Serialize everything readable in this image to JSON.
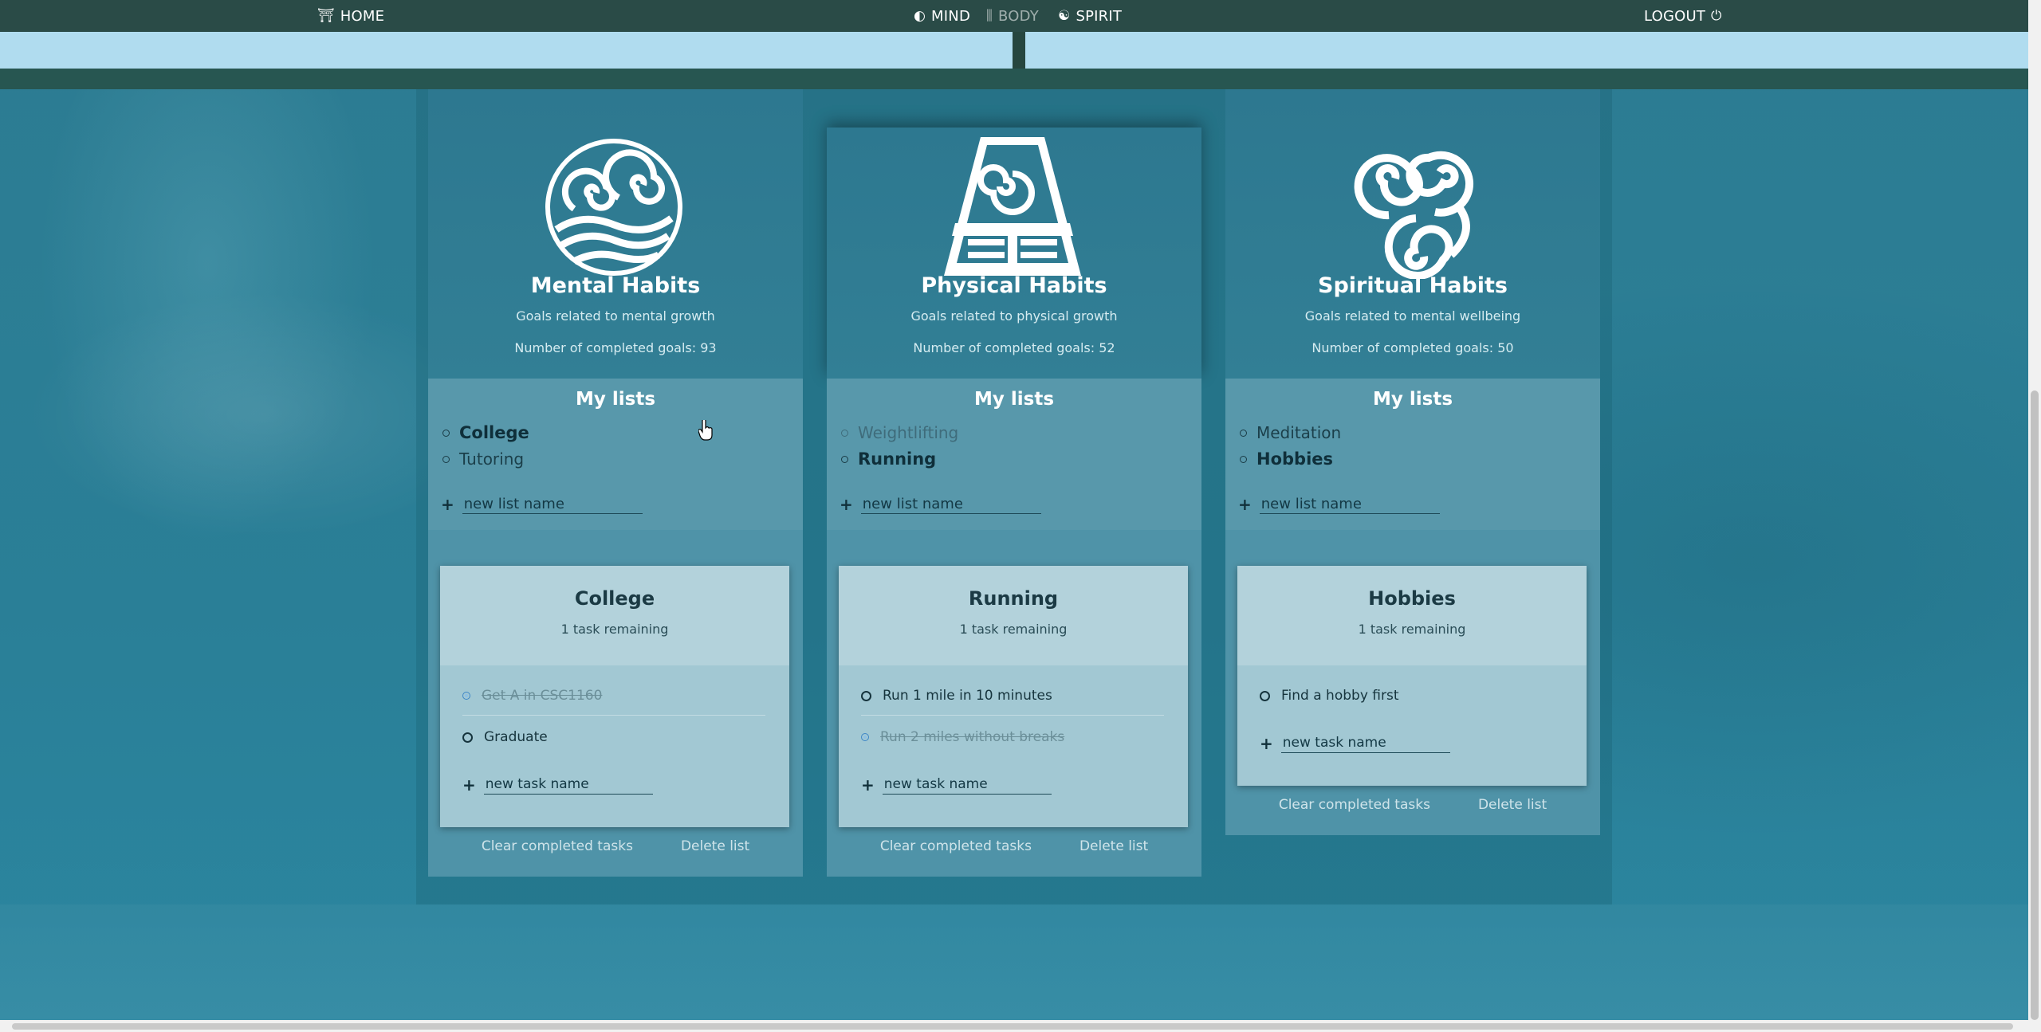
{
  "nav": {
    "home": "HOME",
    "mind": "MIND",
    "body": "BODY",
    "spirit": "SPIRIT",
    "logout": "LOGOUT"
  },
  "columns": [
    {
      "emblem": "water-tribe-emblem",
      "title": "Mental Habits",
      "description": "Goals related to mental growth",
      "completed": "Number of completed goals: 93",
      "lists_title": "My lists",
      "lists": [
        {
          "label": "College",
          "state": "active"
        },
        {
          "label": "Tutoring",
          "state": "normal"
        }
      ],
      "new_list_placeholder": "new list name",
      "card": {
        "title": "College",
        "remaining": "1 task remaining",
        "tasks": [
          {
            "label": "Get A in CSC1160",
            "done": true
          },
          {
            "label": "Graduate",
            "done": false
          }
        ],
        "new_task_placeholder": "new task name",
        "clear_label": "Clear completed tasks",
        "delete_label": "Delete list"
      }
    },
    {
      "emblem": "earth-kingdom-emblem",
      "title": "Physical Habits",
      "description": "Goals related to physical growth",
      "completed": "Number of completed goals: 52",
      "lists_title": "My lists",
      "lists": [
        {
          "label": "Weightlifting",
          "state": "muted"
        },
        {
          "label": "Running",
          "state": "active"
        }
      ],
      "new_list_placeholder": "new list name",
      "card": {
        "title": "Running",
        "remaining": "1 task remaining",
        "tasks": [
          {
            "label": "Run 1 mile in 10 minutes",
            "done": false
          },
          {
            "label": "Run 2 miles without breaks",
            "done": true
          }
        ],
        "new_task_placeholder": "new task name",
        "clear_label": "Clear completed tasks",
        "delete_label": "Delete list"
      }
    },
    {
      "emblem": "air-nomad-emblem",
      "title": "Spiritual Habits",
      "description": "Goals related to mental wellbeing",
      "completed": "Number of completed goals: 50",
      "lists_title": "My lists",
      "lists": [
        {
          "label": "Meditation",
          "state": "normal"
        },
        {
          "label": "Hobbies",
          "state": "active"
        }
      ],
      "new_list_placeholder": "new list name",
      "card": {
        "title": "Hobbies",
        "remaining": "1 task remaining",
        "tasks": [
          {
            "label": "Find a hobby first",
            "done": false
          }
        ],
        "new_task_placeholder": "new task name",
        "clear_label": "Clear completed tasks",
        "delete_label": "Delete list"
      }
    }
  ],
  "colors": {
    "navbar": "#2a4b47",
    "page_bg": "#2e7f95",
    "lists_bg": "#5898ab",
    "card_bg": "#a2c8d3"
  }
}
